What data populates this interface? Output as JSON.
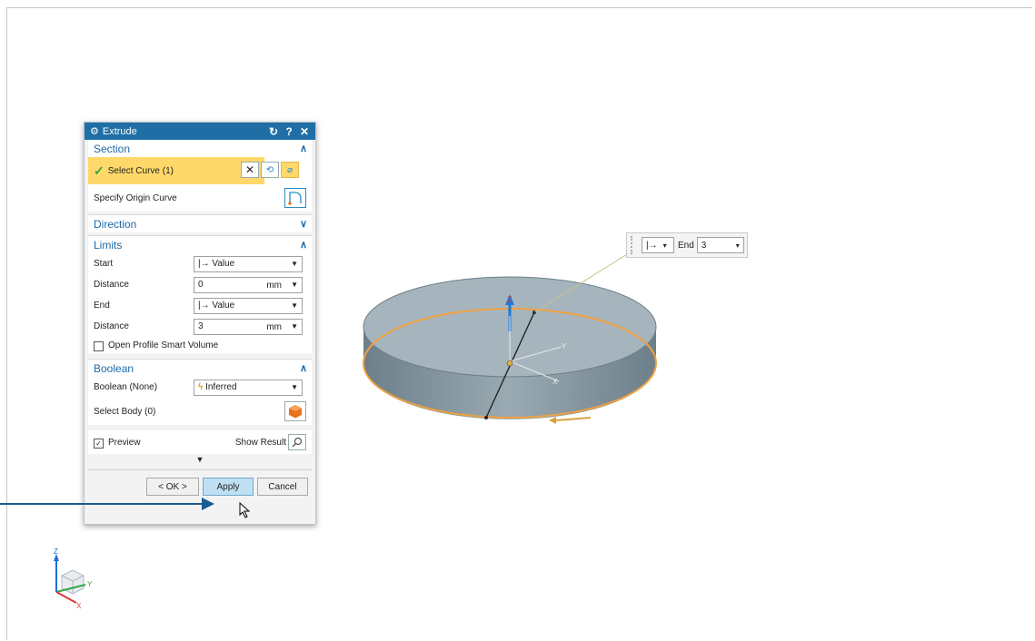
{
  "dialog": {
    "title": "Extrude",
    "reset_icon": "↻",
    "help_icon": "?",
    "close_icon": "✕"
  },
  "section": {
    "header": "Section",
    "select_curve": "Select Curve (1)",
    "specify_origin": "Specify Origin Curve"
  },
  "direction": {
    "header": "Direction"
  },
  "limits": {
    "header": "Limits",
    "start_label": "Start",
    "start_value": "Value",
    "distance1_label": "Distance",
    "distance1_value": "0",
    "distance1_unit": "mm",
    "end_label": "End",
    "end_value": "Value",
    "distance2_label": "Distance",
    "distance2_value": "3",
    "distance2_unit": "mm",
    "open_profile": "Open Profile Smart Volume"
  },
  "boolean": {
    "header": "Boolean",
    "boolean_label": "Boolean (None)",
    "boolean_value": "Inferred",
    "select_body": "Select Body (0)"
  },
  "footer": {
    "preview_label": "Preview",
    "show_result": "Show Result",
    "ok": "< OK >",
    "apply": "Apply",
    "cancel": "Cancel"
  },
  "mini_toolbar": {
    "end_label": "End",
    "end_value": "3"
  },
  "viewport": {
    "axis_z": "Z",
    "axis_y": "Y",
    "axis_x": "X",
    "triad_z": "Z",
    "triad_y": "Y",
    "triad_x": "X"
  },
  "colors": {
    "accent": "#1f6fa6",
    "selection": "#ffd86a",
    "disk_top": "#a8b7bf",
    "disk_side": "#7d8f99",
    "edge_highlight": "#f0a040"
  }
}
